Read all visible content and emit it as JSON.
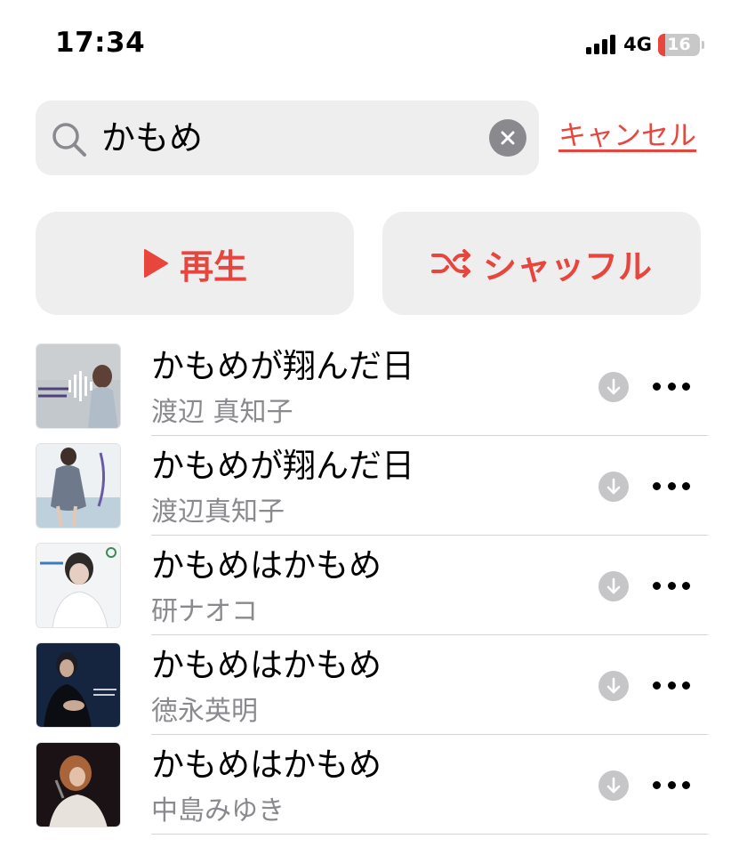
{
  "status_bar": {
    "time": "17:34",
    "network": "4G",
    "battery": "16",
    "battery_level": 0.16
  },
  "search": {
    "query": "かもめ",
    "cancel_label": "キャンセル"
  },
  "actions": {
    "play_label": "再生",
    "shuffle_label": "シャッフル"
  },
  "songs": [
    {
      "title": "かもめが翔んだ日",
      "artist": "渡辺 真知子",
      "now_playing": true
    },
    {
      "title": "かもめが翔んだ日",
      "artist": "渡辺真知子",
      "now_playing": false
    },
    {
      "title": "かもめはかもめ",
      "artist": "研ナオコ",
      "now_playing": false
    },
    {
      "title": "かもめはかもめ",
      "artist": "徳永英明",
      "now_playing": false
    },
    {
      "title": "かもめはかもめ",
      "artist": "中島みゆき",
      "now_playing": false
    }
  ],
  "colors": {
    "accent": "#e8453c",
    "secondary_text": "#8a8a8e",
    "fill": "#eeeeef"
  }
}
